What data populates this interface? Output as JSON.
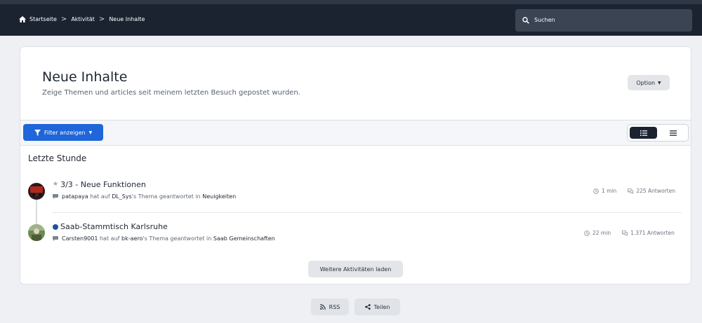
{
  "breadcrumb": {
    "items": [
      "Startseite",
      "Aktivität",
      "Neue Inhalte"
    ],
    "separator": ">",
    "home_icon": "home-icon"
  },
  "search": {
    "placeholder": "Suchen",
    "icon": "search-icon"
  },
  "page": {
    "title": "Neue Inhalte",
    "subtitle": "Zeige Themen und articles seit meinem letzten Besuch gepostet wurden.",
    "option_label": "Option"
  },
  "toolbar": {
    "filter_label": "Filter anzeigen",
    "filter_icon": "filter-icon",
    "view_modes": [
      "expanded-list",
      "condensed-list"
    ],
    "active_view": "expanded-list"
  },
  "section": {
    "heading": "Letzte Stunde"
  },
  "items": [
    {
      "title": "3/3 - Neue Funktionen",
      "marker": "star-icon",
      "user": "patapaya",
      "text_1": "hat auf",
      "thread_author": "DL_Sys",
      "text_2": "'s Thema geantwortet in",
      "forum": "Neuigkeiten",
      "time": "1 min",
      "replies": "225 Antworten"
    },
    {
      "title": "Saab-Stammtisch Karlsruhe",
      "marker": "unread-dot",
      "user": "Carsten9001",
      "text_1": "hat auf",
      "thread_author": "bk-aero",
      "text_2": "'s Thema geantwortet in",
      "forum": "Saab Gemeinschaften",
      "time": "22 min",
      "replies": "1.371 Antworten"
    }
  ],
  "load_more_label": "Weitere Aktivitäten laden",
  "footer": {
    "rss_label": "RSS",
    "share_label": "Teilen"
  },
  "colors": {
    "header_bg": "#1b2331",
    "primary_blue": "#1e66d9",
    "page_bg": "#eef0f3",
    "unread_dot": "#1f4f9e"
  }
}
